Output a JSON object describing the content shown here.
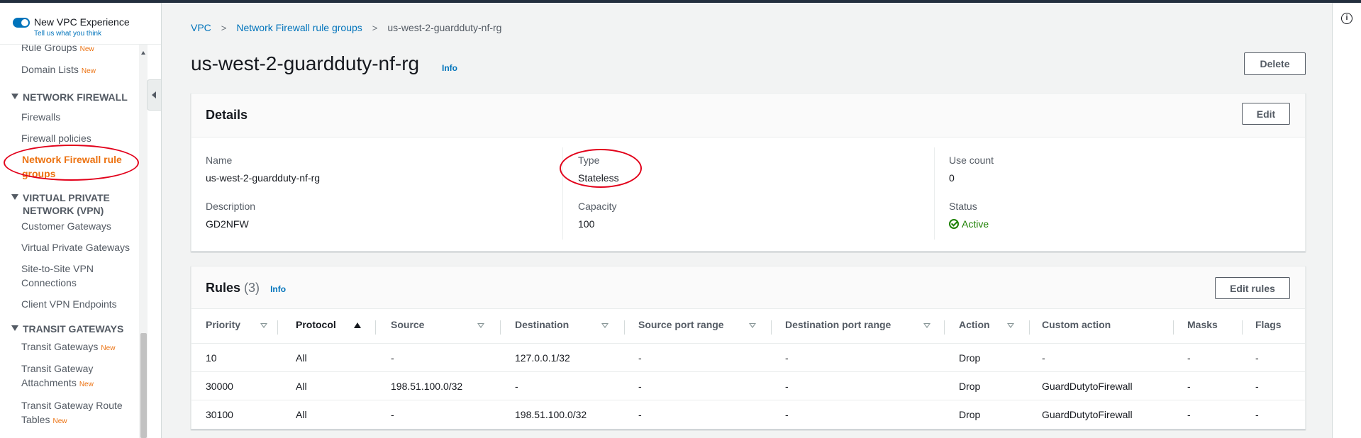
{
  "sidebar": {
    "new_experience": {
      "label": "New VPC Experience",
      "feedback_link": "Tell us what you think"
    },
    "items": {
      "rule_groups": {
        "label": "Rule Groups",
        "badge": "New"
      },
      "domain_lists": {
        "label": "Domain Lists",
        "badge": "New"
      },
      "firewalls": {
        "label": "Firewalls"
      },
      "firewall_policies": {
        "label": "Firewall policies"
      },
      "nf_rule_groups": {
        "label": "Network Firewall rule groups"
      },
      "customer_gateways": {
        "label": "Customer Gateways"
      },
      "virtual_private_gateways": {
        "label": "Virtual Private Gateways"
      },
      "site_to_site_vpn": {
        "label": "Site-to-Site VPN Connections"
      },
      "client_vpn_endpoints": {
        "label": "Client VPN Endpoints"
      },
      "transit_gateways": {
        "label": "Transit Gateways",
        "badge": "New"
      },
      "tgw_attachments": {
        "label": "Transit Gateway Attachments",
        "badge": "New"
      },
      "tgw_route_tables": {
        "label": "Transit Gateway Route Tables",
        "badge": "New"
      }
    },
    "sections": {
      "network_firewall": "NETWORK FIREWALL",
      "vpn": "VIRTUAL PRIVATE NETWORK (VPN)",
      "transit_gateways": "TRANSIT GATEWAYS"
    }
  },
  "breadcrumb": {
    "vpc": "VPC",
    "rule_groups": "Network Firewall rule groups",
    "current": "us-west-2-guardduty-nf-rg",
    "separator": ">"
  },
  "page": {
    "title": "us-west-2-guardduty-nf-rg",
    "info": "Info",
    "delete_button": "Delete"
  },
  "details": {
    "title": "Details",
    "edit_button": "Edit",
    "name_label": "Name",
    "name_value": "us-west-2-guardduty-nf-rg",
    "description_label": "Description",
    "description_value": "GD2NFW",
    "type_label": "Type",
    "type_value": "Stateless",
    "capacity_label": "Capacity",
    "capacity_value": "100",
    "use_count_label": "Use count",
    "use_count_value": "0",
    "status_label": "Status",
    "status_value": "Active"
  },
  "rules": {
    "title": "Rules",
    "count": "(3)",
    "info": "Info",
    "edit_button": "Edit rules",
    "columns": [
      "Priority",
      "Protocol",
      "Source",
      "Destination",
      "Source port range",
      "Destination port range",
      "Action",
      "Custom action",
      "Masks",
      "Flags"
    ],
    "rows": [
      [
        "10",
        "All",
        "-",
        "127.0.0.1/32",
        "-",
        "-",
        "Drop",
        "-",
        "-",
        "-"
      ],
      [
        "30000",
        "All",
        "198.51.100.0/32",
        "-",
        "-",
        "-",
        "Drop",
        "GuardDutytoFirewall",
        "-",
        "-"
      ],
      [
        "30100",
        "All",
        "-",
        "198.51.100.0/32",
        "-",
        "-",
        "Drop",
        "GuardDutytoFirewall",
        "-",
        "-"
      ]
    ]
  },
  "colors": {
    "link": "#0073bb",
    "active_nav": "#ec7211",
    "success": "#1d8102",
    "annotation": "#e2001a"
  }
}
